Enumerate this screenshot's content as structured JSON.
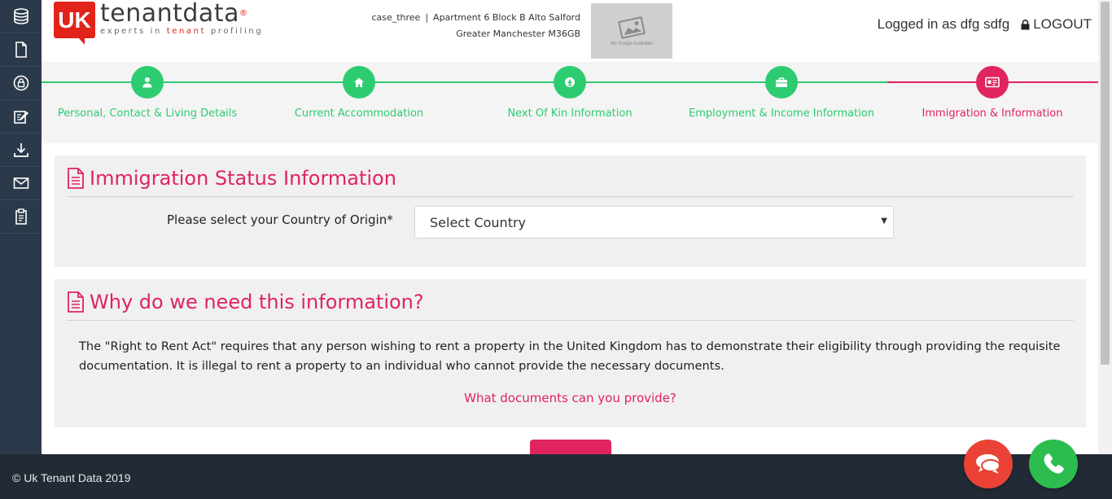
{
  "sidebar": {
    "items": [
      {
        "icon": "database-icon"
      },
      {
        "icon": "document-icon"
      },
      {
        "icon": "lock-icon"
      },
      {
        "icon": "edit-icon"
      },
      {
        "icon": "download-icon"
      },
      {
        "icon": "mail-icon"
      },
      {
        "icon": "clipboard-icon"
      }
    ]
  },
  "header": {
    "logo_mark": "UK",
    "logo_name": "tenantdata",
    "logo_reg": "®",
    "logo_tag_prefix": "experts in ",
    "logo_tag_highlight": "tenant",
    "logo_tag_suffix": " profiling",
    "case_name": "case_three",
    "separator": "|",
    "address_line1": "Apartment 6 Block B Alto Salford",
    "address_line2": "Greater Manchester M36GB",
    "no_image_text": "No Image Available",
    "logged_in_text": "Logged in as dfg sdfg",
    "logout_label": "LOGOUT"
  },
  "steps": [
    {
      "label": "Personal, Contact & Living Details",
      "icon": "user-icon",
      "state": "done"
    },
    {
      "label": "Current Accommodation",
      "icon": "home-icon",
      "state": "done"
    },
    {
      "label": "Next Of Kin Information",
      "icon": "info-icon",
      "state": "done"
    },
    {
      "label": "Employment & Income Information",
      "icon": "briefcase-icon",
      "state": "done"
    },
    {
      "label": "Immigration & Information",
      "icon": "id-card-icon",
      "state": "active"
    }
  ],
  "colors": {
    "done": "#2ecc71",
    "active": "#e0245e"
  },
  "immigration_panel": {
    "title": "Immigration Status Information",
    "country_label": "Please select your Country of Origin*",
    "country_select_value": "Select Country"
  },
  "why_panel": {
    "title": "Why do we need this information?",
    "paragraph": "The \"Right to Rent Act\" requires that any person wishing to rent a property in the United Kingdom has to demonstrate their eligibility through providing the requisite documentation. It is illegal to rent a property to an individual who cannot provide the necessary documents.",
    "link": "What documents can you provide?"
  },
  "footer": {
    "copyright": "© Uk Tenant Data 2019"
  }
}
